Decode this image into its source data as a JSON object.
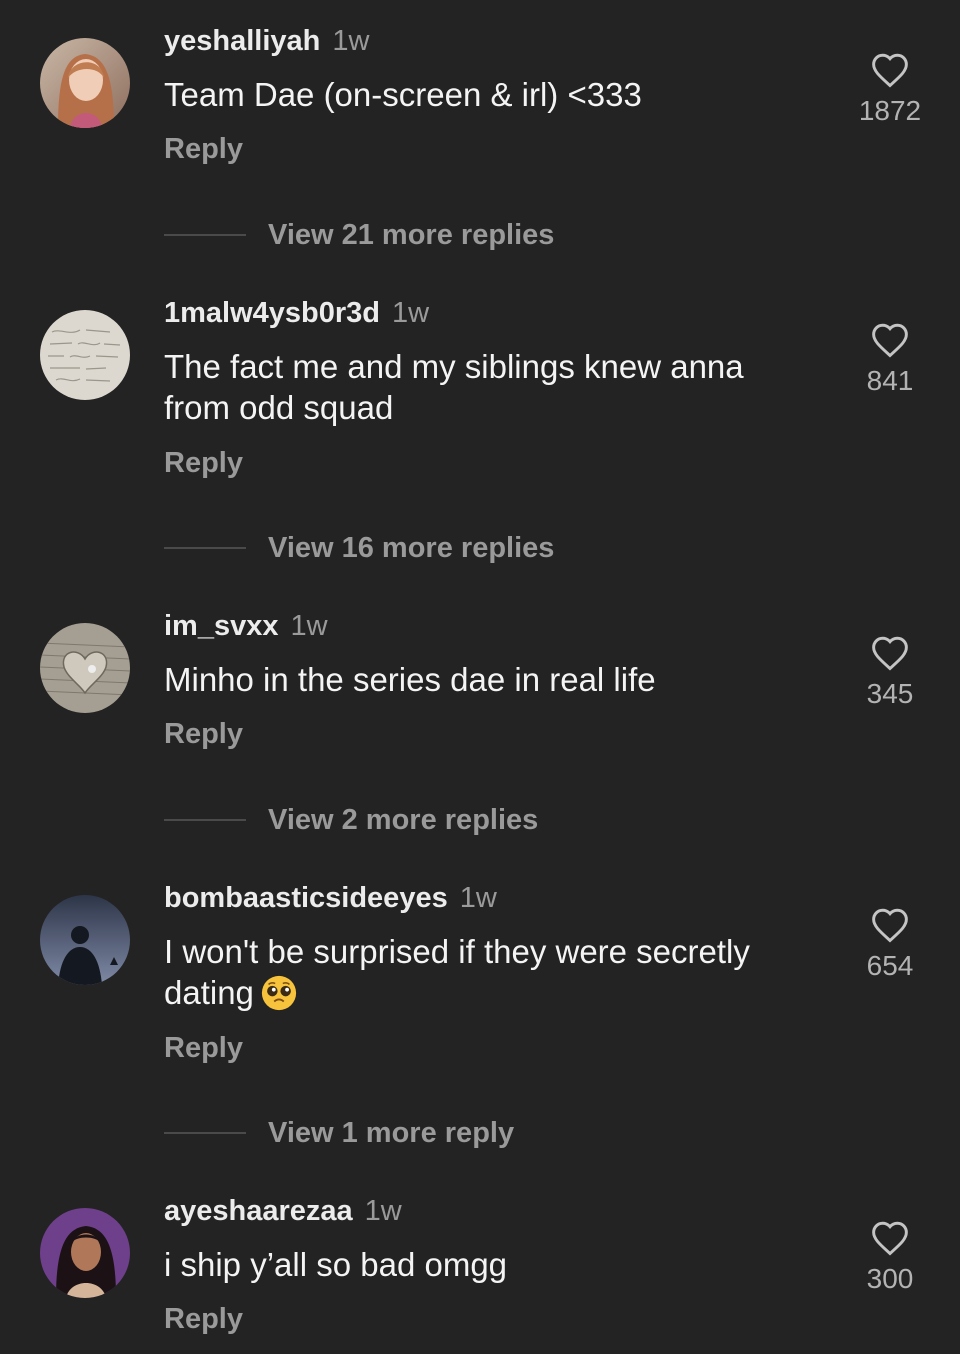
{
  "comments": [
    {
      "username": "yeshalliyah",
      "time": "1w",
      "text": "Team Dae (on-screen & irl) <333",
      "reply_label": "Reply",
      "likes": "1872",
      "view_more": "View 21 more replies",
      "avatar": "woman-portrait-avatar"
    },
    {
      "username": "1malw4ysb0r3d",
      "time": "1w",
      "text": "The fact me and my siblings knew anna from odd squad",
      "reply_label": "Reply",
      "likes": "841",
      "view_more": "View 16 more replies",
      "avatar": "handwritten-notes-avatar"
    },
    {
      "username": "im_svxx",
      "time": "1w",
      "text": "Minho in the series dae in real life",
      "reply_label": "Reply",
      "likes": "345",
      "view_more": "View 2 more replies",
      "avatar": "book-heart-avatar"
    },
    {
      "username": "bombaasticsideeyes",
      "time": "1w",
      "text": "I won't be surprised if they were secretly dating",
      "emoji": "pleading-face-emoji",
      "reply_label": "Reply",
      "likes": "654",
      "view_more": "View 1 more reply",
      "avatar": "silhouette-avatar"
    },
    {
      "username": "ayeshaarezaa",
      "time": "1w",
      "text": "i ship y’all so bad omgg",
      "reply_label": "Reply",
      "likes": "300",
      "avatar": "woman-portrait-purple-avatar"
    }
  ],
  "colors": {
    "background": "#232323",
    "primary_text": "#f4f4f4",
    "secondary_text": "#9a9a9a",
    "like_icon": "#c4c4c4"
  }
}
